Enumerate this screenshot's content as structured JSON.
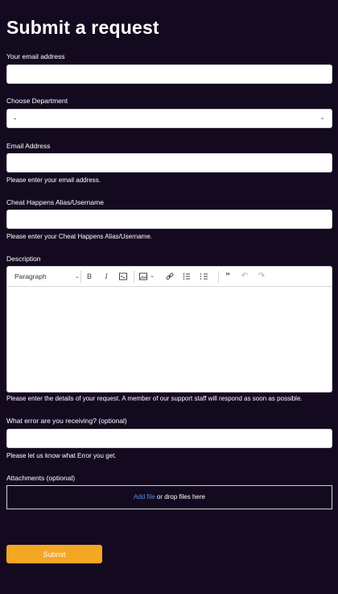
{
  "page": {
    "title": "Submit a request"
  },
  "form": {
    "email": {
      "label": "Your email address",
      "value": ""
    },
    "department": {
      "label": "Choose Department",
      "selected": "-"
    },
    "email_address": {
      "label": "Email Address",
      "value": "",
      "hint": "Please enter your email address."
    },
    "alias": {
      "label": "Cheat Happens Alias/Username",
      "value": "",
      "hint": "Please enter your Cheat Happens Alias/Username."
    },
    "description": {
      "label": "Description",
      "paragraph_style": "Paragraph",
      "value": "",
      "hint": "Please enter the details of your request. A member of our support staff will respond as soon as possible.",
      "toolbar_icons": [
        "bold-icon",
        "italic-icon",
        "code-icon",
        "image-icon",
        "link-icon",
        "bulleted-list-icon",
        "numbered-list-icon",
        "quote-icon",
        "undo-icon",
        "redo-icon"
      ]
    },
    "error": {
      "label": "What error are you receiving? (optional)",
      "value": "",
      "hint": "Please let us know what Error you get."
    },
    "attachments": {
      "label": "Attachments (optional)",
      "add_file": "Add file",
      "drop_text": " or drop files here"
    },
    "submit_label": "Submit"
  },
  "colors": {
    "background": "#140a20",
    "accent": "#f5a623",
    "link": "#4a90e2"
  }
}
